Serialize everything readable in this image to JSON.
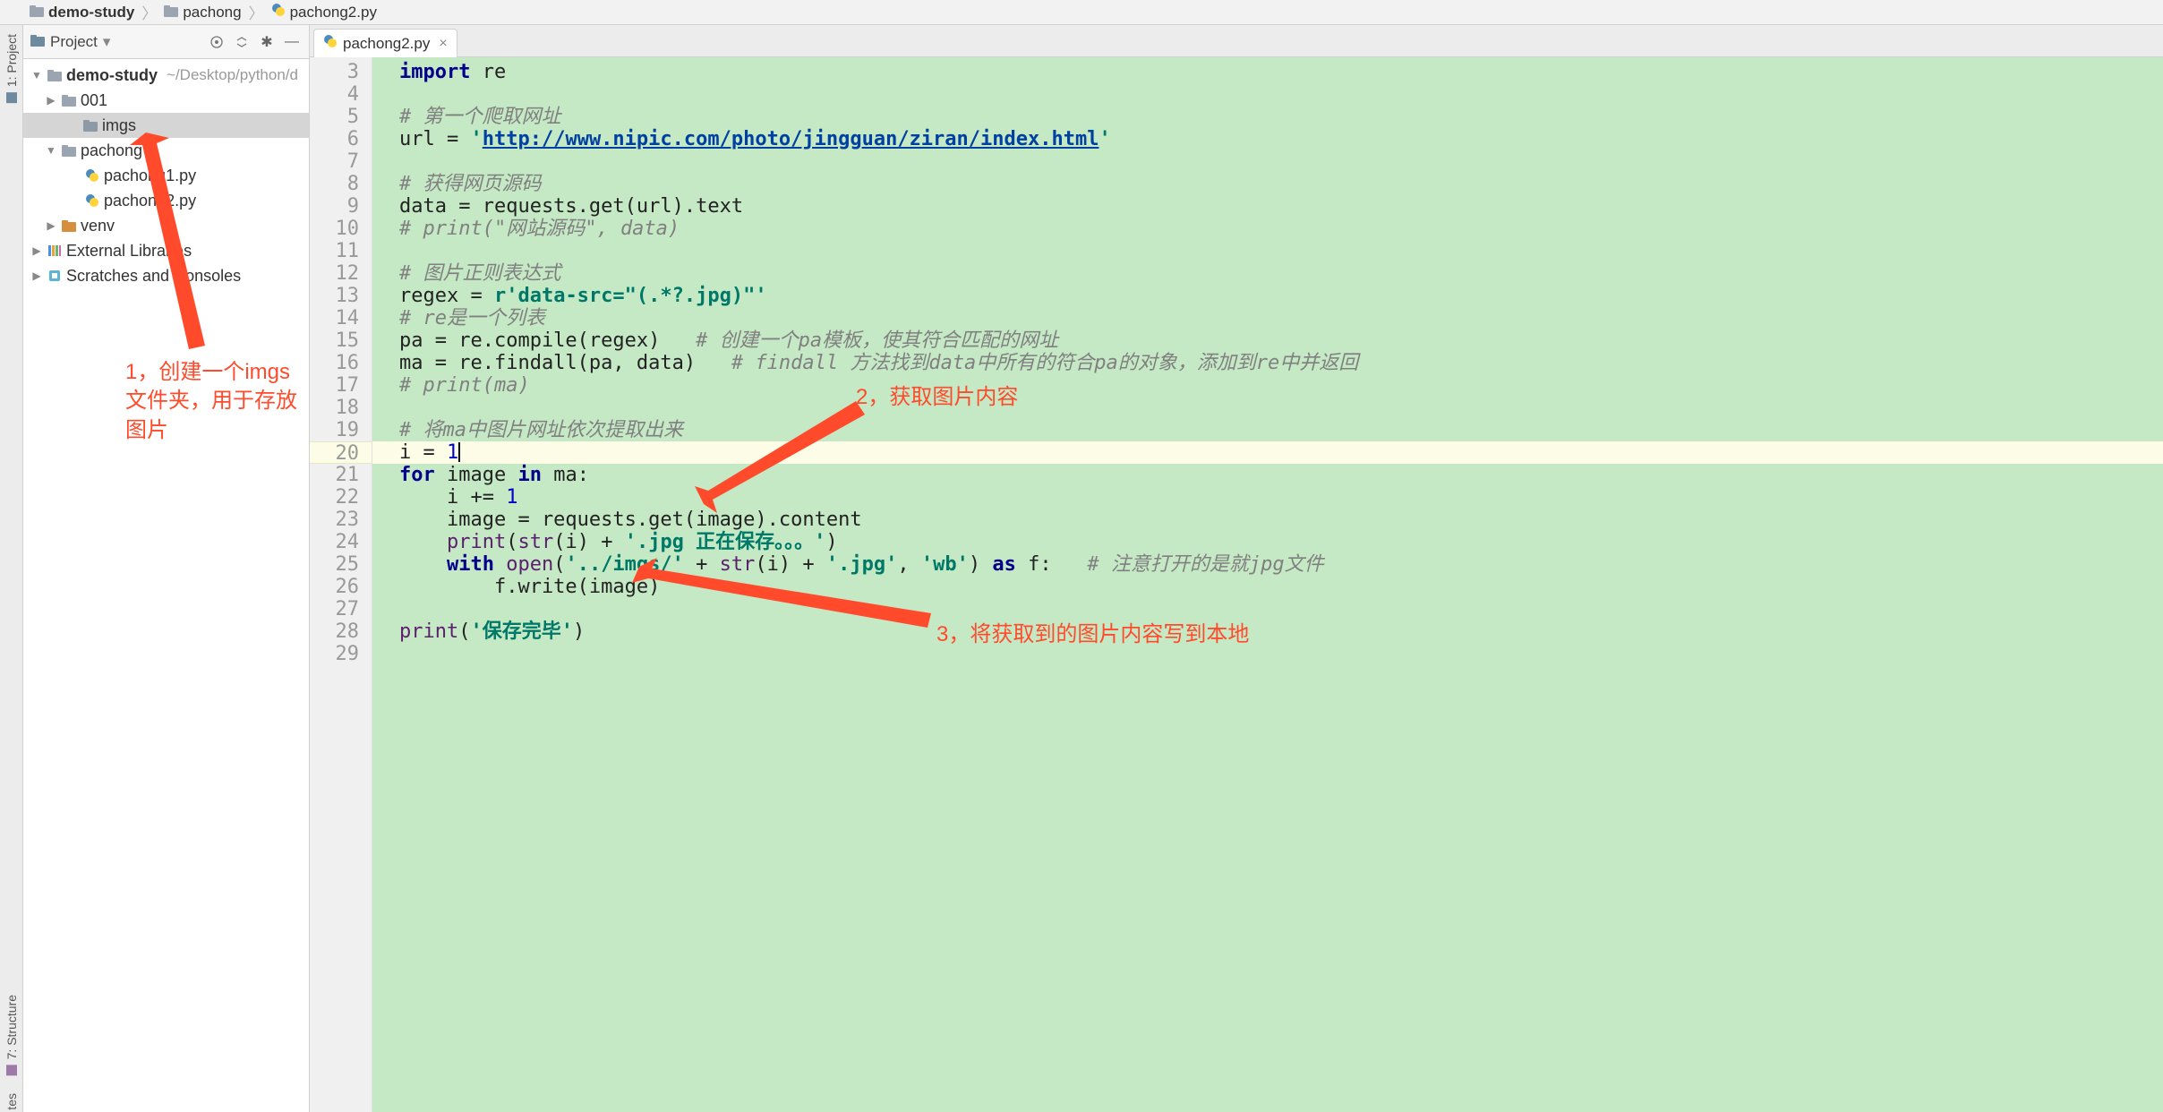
{
  "breadcrumbs": [
    {
      "icon": "folder",
      "label": "demo-study"
    },
    {
      "icon": "folder",
      "label": "pachong"
    },
    {
      "icon": "python",
      "label": "pachong2.py"
    }
  ],
  "left_gutter": {
    "project_tab": "1: Project",
    "structure_tab": "7: Structure",
    "fav_bottom": "tes"
  },
  "project_panel": {
    "title": "Project",
    "actions": [
      "target",
      "collapse",
      "settings",
      "minimize"
    ],
    "tree": {
      "root": {
        "label": "demo-study",
        "path": "~/Desktop/python/d"
      },
      "items": [
        {
          "label": "001",
          "type": "dir",
          "indent": 1,
          "arrow": "right"
        },
        {
          "label": "imgs",
          "type": "dir",
          "indent": 2,
          "arrow": "none",
          "selected": true
        },
        {
          "label": "pachong",
          "type": "dir",
          "indent": 1,
          "arrow": "down"
        },
        {
          "label": "pachong1.py",
          "type": "py",
          "indent": 2
        },
        {
          "label": "pachong2.py",
          "type": "py",
          "indent": 2
        },
        {
          "label": "venv",
          "type": "dir-env",
          "indent": 1,
          "arrow": "right"
        }
      ],
      "extras": [
        {
          "label": "External Libraries",
          "type": "libs",
          "arrow": "right"
        },
        {
          "label": "Scratches and Consoles",
          "type": "scratch",
          "arrow": "right"
        }
      ]
    }
  },
  "editor": {
    "tab": "pachong2.py",
    "first_line_no": 3,
    "last_line_no": 29,
    "current_line_no": 20,
    "lines": {
      "3": {
        "segments": [
          {
            "t": "import ",
            "c": "kw"
          },
          {
            "t": "re"
          }
        ]
      },
      "4": {
        "segments": []
      },
      "5": {
        "segments": [
          {
            "t": "# 第一个爬取网址",
            "c": "cmt"
          }
        ]
      },
      "6": {
        "segments": [
          {
            "t": "url = "
          },
          {
            "t": "'",
            "c": "str"
          },
          {
            "t": "http://www.nipic.com/photo/jingguan/ziran/index.html",
            "c": "strlink"
          },
          {
            "t": "'",
            "c": "str"
          }
        ]
      },
      "7": {
        "segments": []
      },
      "8": {
        "segments": [
          {
            "t": "# 获得网页源码",
            "c": "cmt"
          }
        ]
      },
      "9": {
        "segments": [
          {
            "t": "data = requests.get(url).text"
          }
        ]
      },
      "10": {
        "segments": [
          {
            "t": "# print(\"网站源码\", data)",
            "c": "cmt"
          }
        ]
      },
      "11": {
        "segments": []
      },
      "12": {
        "segments": [
          {
            "t": "# 图片正则表达式",
            "c": "cmt"
          }
        ]
      },
      "13": {
        "segments": [
          {
            "t": "regex = "
          },
          {
            "t": "r'data-src=\"(.*?.jpg)\"'",
            "c": "str"
          }
        ]
      },
      "14": {
        "segments": [
          {
            "t": "# re是一个列表",
            "c": "cmt"
          }
        ]
      },
      "15": {
        "segments": [
          {
            "t": "pa = re.compile(regex)   "
          },
          {
            "t": "# 创建一个pa模板，使其符合匹配的网址",
            "c": "cmt"
          }
        ]
      },
      "16": {
        "segments": [
          {
            "t": "ma = re.findall(pa, data)   "
          },
          {
            "t": "# findall 方法找到data中所有的符合pa的对象，添加到re中并返回",
            "c": "cmt"
          }
        ]
      },
      "17": {
        "segments": [
          {
            "t": "# print(ma)",
            "c": "cmt"
          }
        ]
      },
      "18": {
        "segments": []
      },
      "19": {
        "segments": [
          {
            "t": "# 将ma中图片网址依次提取出来",
            "c": "cmt"
          }
        ]
      },
      "20": {
        "segments": [
          {
            "t": "i = "
          },
          {
            "t": "1",
            "c": "num"
          }
        ],
        "cursor_after": true,
        "highlight": true
      },
      "21": {
        "segments": [
          {
            "t": "for ",
            "c": "kw"
          },
          {
            "t": "image "
          },
          {
            "t": "in ",
            "c": "kw"
          },
          {
            "t": "ma:"
          }
        ]
      },
      "22": {
        "segments": [
          {
            "t": "    i += "
          },
          {
            "t": "1",
            "c": "num"
          }
        ]
      },
      "23": {
        "segments": [
          {
            "t": "    image = requests.get(image).content"
          }
        ]
      },
      "24": {
        "segments": [
          {
            "t": "    "
          },
          {
            "t": "print",
            "c": "builtin"
          },
          {
            "t": "("
          },
          {
            "t": "str",
            "c": "builtin"
          },
          {
            "t": "(i) + "
          },
          {
            "t": "'.jpg 正在保存。。。'",
            "c": "str"
          },
          {
            "t": ")"
          }
        ]
      },
      "25": {
        "segments": [
          {
            "t": "    "
          },
          {
            "t": "with ",
            "c": "kw"
          },
          {
            "t": "open",
            "c": "builtin"
          },
          {
            "t": "("
          },
          {
            "t": "'../imgs/'",
            "c": "str"
          },
          {
            "t": " + "
          },
          {
            "t": "str",
            "c": "builtin"
          },
          {
            "t": "(i) + "
          },
          {
            "t": "'.jpg'",
            "c": "str"
          },
          {
            "t": ", "
          },
          {
            "t": "'wb'",
            "c": "str"
          },
          {
            "t": ") "
          },
          {
            "t": "as ",
            "c": "kw"
          },
          {
            "t": "f:   "
          },
          {
            "t": "# 注意打开的是就jpg文件",
            "c": "cmt"
          }
        ]
      },
      "26": {
        "segments": [
          {
            "t": "        f.write(image)"
          }
        ]
      },
      "27": {
        "segments": []
      },
      "28": {
        "segments": [
          {
            "t": "print",
            "c": "builtin"
          },
          {
            "t": "("
          },
          {
            "t": "'保存完毕'",
            "c": "str"
          },
          {
            "t": ")"
          }
        ]
      },
      "29": {
        "segments": []
      }
    }
  },
  "annotations": {
    "a1": "1，创建一个imgs文件夹，用于存放图片",
    "a2": "2，获取图片内容",
    "a3": "3，将获取到的图片内容写到本地"
  }
}
